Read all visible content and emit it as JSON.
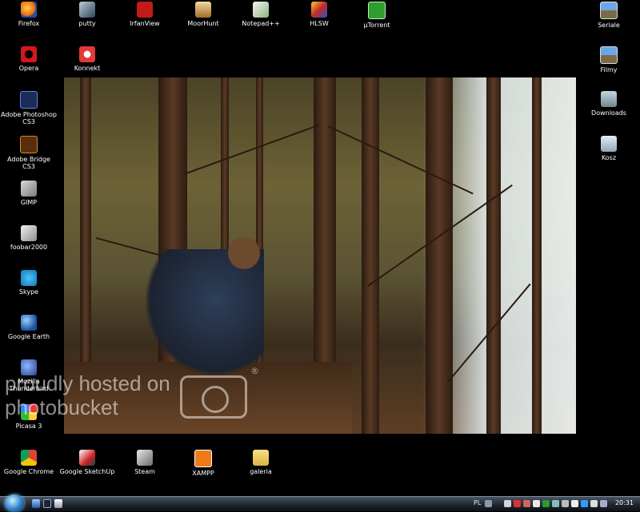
{
  "desktop": {
    "icons": [
      {
        "label": "Firefox"
      },
      {
        "label": "putty"
      },
      {
        "label": "IrfanView"
      },
      {
        "label": "MoorHunt"
      },
      {
        "label": "Notepad++"
      },
      {
        "label": "HLSW"
      },
      {
        "label": "µTorrent"
      },
      {
        "label": "Seriale"
      },
      {
        "label": "Opera"
      },
      {
        "label": "Konnekt"
      },
      {
        "label": "Filmy"
      },
      {
        "label": "Adobe Photoshop CS3"
      },
      {
        "label": "Downloads"
      },
      {
        "label": "Adobe Bridge CS3"
      },
      {
        "label": "Kosz"
      },
      {
        "label": "GIMP"
      },
      {
        "label": "foobar2000"
      },
      {
        "label": "Skype"
      },
      {
        "label": "Google Earth"
      },
      {
        "label": "Mozilla Thunderbird"
      },
      {
        "label": "Picasa 3"
      },
      {
        "label": "Google Chrome"
      },
      {
        "label": "Google SketchUp"
      },
      {
        "label": "Steam"
      },
      {
        "label": "XAMPP"
      },
      {
        "label": "galeria"
      }
    ]
  },
  "photo": {
    "watermark_line1": "proudly hosted on",
    "watermark_line2": "photobucket",
    "watermark_reg": "®"
  },
  "taskbar": {
    "language": "PL",
    "clock": "20:31"
  }
}
